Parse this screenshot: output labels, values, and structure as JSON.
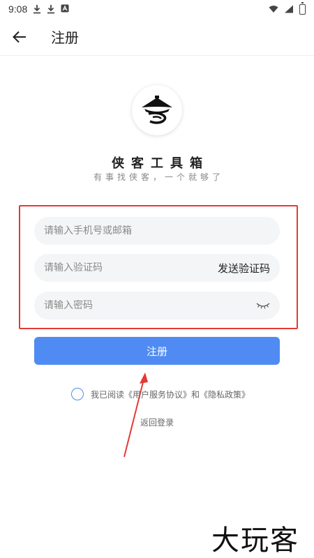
{
  "status_bar": {
    "time": "9:08"
  },
  "app_bar": {
    "title": "注册"
  },
  "brand": {
    "name": "侠客工具箱",
    "slogan": "有事找侠客，一个就够了"
  },
  "form": {
    "account_placeholder": "请输入手机号或邮箱",
    "code_placeholder": "请输入验证码",
    "send_code_label": "发送验证码",
    "password_placeholder": "请输入密码",
    "register_label": "注册"
  },
  "agreement": {
    "prefix": "我已阅读",
    "user_agreement": "《用户服务协议》",
    "and": "和",
    "privacy_policy": "《隐私政策》"
  },
  "back_to_login": "返回登录",
  "watermark": "大玩客",
  "colors": {
    "accent": "#4f8bf2",
    "annotation": "#e53935"
  }
}
